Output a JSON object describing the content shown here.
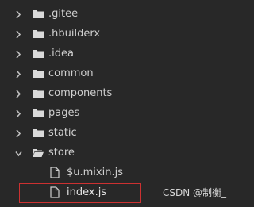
{
  "tree": {
    "items": [
      {
        "label": ".gitee",
        "type": "folder",
        "expanded": false
      },
      {
        "label": ".hbuilderx",
        "type": "folder",
        "expanded": false
      },
      {
        "label": ".idea",
        "type": "folder",
        "expanded": false
      },
      {
        "label": "common",
        "type": "folder",
        "expanded": false
      },
      {
        "label": "components",
        "type": "folder",
        "expanded": false
      },
      {
        "label": "pages",
        "type": "folder",
        "expanded": false
      },
      {
        "label": "static",
        "type": "folder",
        "expanded": false
      },
      {
        "label": "store",
        "type": "folder",
        "expanded": true
      },
      {
        "label": "$u.mixin.js",
        "type": "file"
      },
      {
        "label": "index.js",
        "type": "file",
        "selected": true
      }
    ]
  },
  "watermark": {
    "text": "CSDN @制衡_"
  },
  "icons": {
    "chevron_collapsed": "chevron-right-icon",
    "chevron_expanded": "chevron-down-icon",
    "folder": "folder-icon",
    "file": "file-icon"
  },
  "colors": {
    "background": "#282828",
    "text": "#cfcfcf",
    "selection_border": "#cc3131"
  }
}
